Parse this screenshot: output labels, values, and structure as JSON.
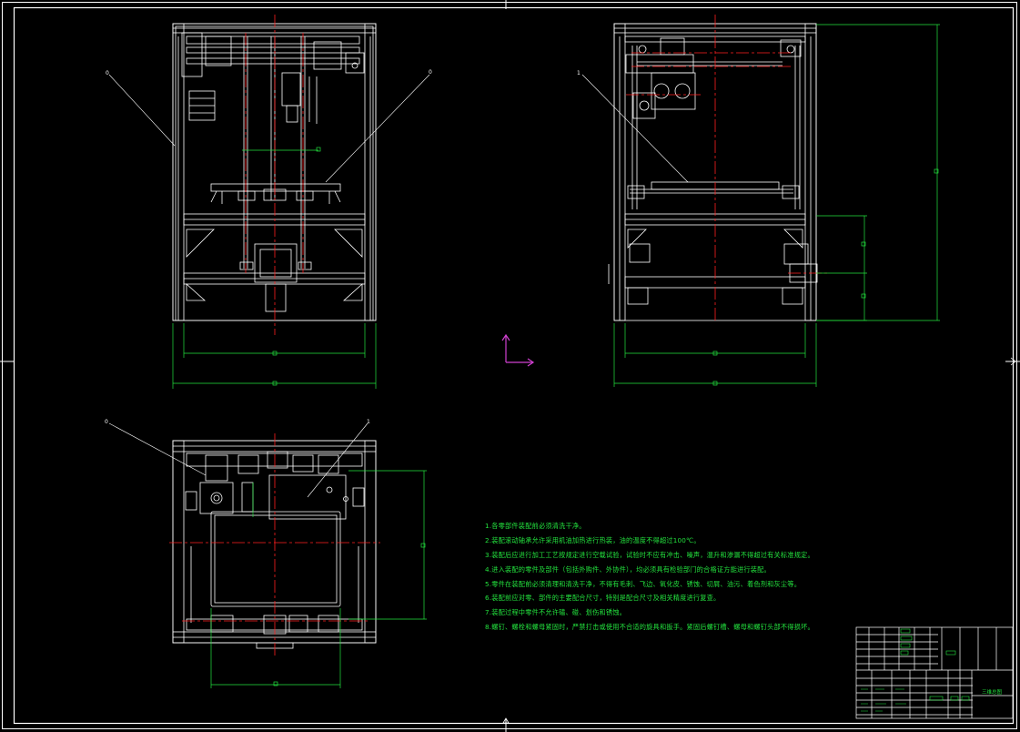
{
  "drawing": {
    "type": "mechanical-assembly",
    "views": [
      "front-view",
      "side-view",
      "top-view"
    ],
    "colors": {
      "background": "#000000",
      "outline": "#ffffff",
      "centerline": "#ff2020",
      "dimension": "#23e23e",
      "ucs": "#d040d0"
    }
  },
  "labels": {
    "front_left_balloon": "0",
    "front_right_balloon": "0",
    "side_balloon": "1",
    "top_left_balloon": "0",
    "top_right_balloon": "1",
    "title_cell": "三维总图"
  },
  "technical_notes": [
    "1.各零部件装配前必须清洗干净。",
    "2.装配滚动轴承允许采用机油加热进行热装，油的温度不得超过100℃。",
    "3.装配后应进行加工工艺按规定进行空载试验，试验时不应有冲击、噪声，温升和渗漏不得超过有关标准规定。",
    "4.进入装配的零件及部件（包括外购件、外协件），均必须具有检验部门的合格证方能进行装配。",
    "5.零件在装配前必须清理和清洗干净，不得有毛刺、飞边、氧化皮、锈蚀、切屑、油污、着色剂和灰尘等。",
    "6.装配前应对零、部件的主要配合尺寸，特别是配合尺寸及相关精度进行复查。",
    "7.装配过程中零件不允许磕、碰、划伤和锈蚀。",
    "8.螺钉、螺栓和螺母紧固时，严禁打击或使用不合适的旋具和扳手。紧固后螺钉槽、螺母和螺钉头部不得损坏。"
  ]
}
